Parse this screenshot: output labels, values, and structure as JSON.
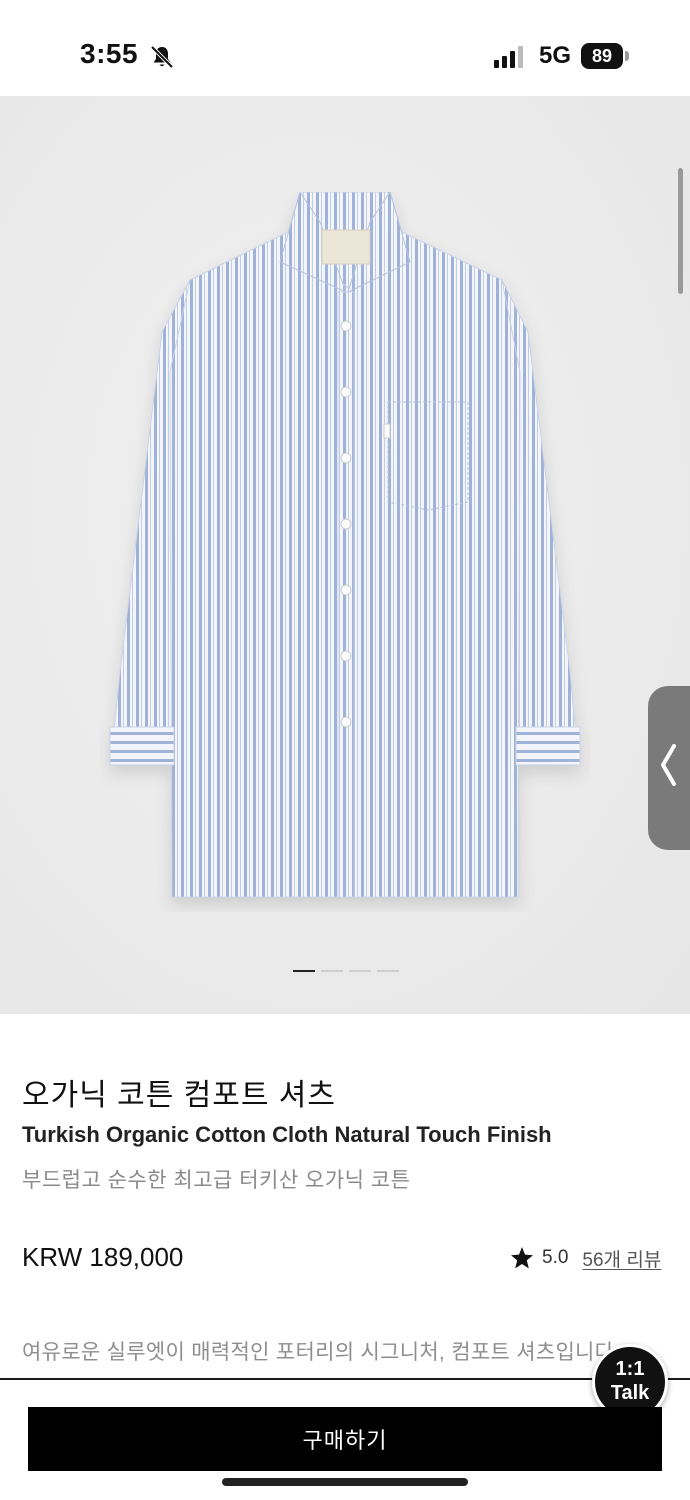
{
  "status_bar": {
    "time": "3:55",
    "network": "5G",
    "battery": "89"
  },
  "gallery": {
    "image_subject": "striped-organic-cotton-shirt",
    "page_count": 4,
    "active_page": 1
  },
  "product": {
    "title": "오가닉 코튼 컴포트 셔츠",
    "subtitle": "Turkish Organic Cotton Cloth Natural Touch Finish",
    "description": "부드럽고 순수한 최고급 터키산 오가닉 코튼",
    "price": "KRW 189,000",
    "rating": "5.0",
    "review_link": "56개 리뷰",
    "intro": "여유로운 실루엣이 매력적인 포터리의 시그니처, 컴포트 셔츠입니다."
  },
  "talk_button": {
    "line1": "1:1",
    "line2": "Talk"
  },
  "buy_button": {
    "label": "구매하기"
  },
  "colors": {
    "accent": "#000000",
    "image_bg": "#ebebeb",
    "shirt_stripe": "#9fb2d8",
    "muted_text": "#8a8a8a"
  }
}
